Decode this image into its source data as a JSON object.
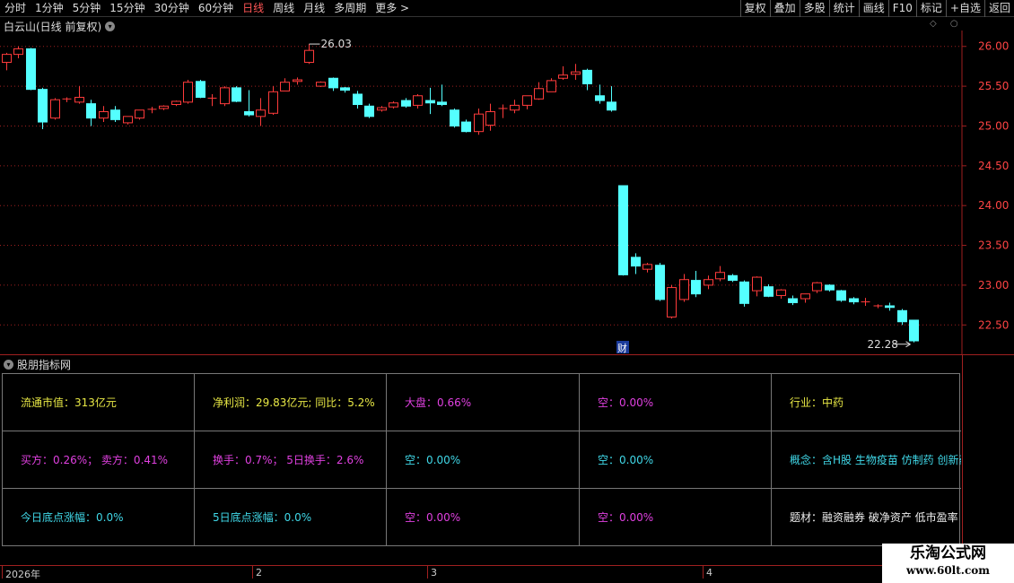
{
  "toolbar": {
    "periods": [
      "分时",
      "1分钟",
      "5分钟",
      "15分钟",
      "30分钟",
      "60分钟",
      "日线",
      "周线",
      "月线",
      "多周期",
      "更多 >"
    ],
    "active_period": "日线",
    "tools": [
      "复权",
      "叠加",
      "多股",
      "统计",
      "画线",
      "F10",
      "标记",
      "+自选",
      "返回"
    ]
  },
  "chart": {
    "title": "白云山(日线 前复权)",
    "header_icons": "◇ ○",
    "high_label": "26.03",
    "low_label": "22.28",
    "event_marker": "财"
  },
  "colors": {
    "up": "#ff3b3b",
    "down": "#54ffff",
    "grid": "#a02020",
    "axis_text": "#ff4444"
  },
  "panel": {
    "title": "股朋指标网",
    "rows": [
      [
        {
          "text": "流通市值：313亿元",
          "color": "yellow"
        },
        {
          "text": "净利润：29.83亿元;  同比：5.2%",
          "color": "yellow"
        },
        {
          "text": "大盘：0.66%",
          "color": "magenta"
        },
        {
          "text": "空：0.00%",
          "color": "magenta"
        },
        {
          "text": "行业：中药",
          "color": "yellow"
        }
      ],
      [
        {
          "text": "买方：0.26%；  卖方：0.41%",
          "color": "magenta"
        },
        {
          "text": "换手：0.7%；  5日换手：2.6%",
          "color": "magenta"
        },
        {
          "text": "空：0.00%",
          "color": "cyan"
        },
        {
          "text": "空：0.00%",
          "color": "cyan"
        },
        {
          "text": "概念：含H股 生物疫苗 仿制药 创新药",
          "color": "cyan"
        }
      ],
      [
        {
          "text": "今日底点涨幅：0.0%",
          "color": "cyan"
        },
        {
          "text": "5日底点涨幅：0.0%",
          "color": "cyan"
        },
        {
          "text": "空：0.00%",
          "color": "magenta"
        },
        {
          "text": "空：0.00%",
          "color": "magenta"
        },
        {
          "text": "题材：融资融券 破净资产 低市盈率 证",
          "color": "white"
        }
      ]
    ]
  },
  "date_axis": {
    "labels": [
      "2026年",
      "2",
      "3",
      "4"
    ]
  },
  "watermark": {
    "line1": "乐淘公式网",
    "line2": "www.60lt.com"
  },
  "chart_data": {
    "type": "candlestick",
    "title": "白云山(日线 前复权)",
    "y_ticks": [
      26.0,
      25.5,
      25.0,
      24.5,
      24.0,
      23.5,
      23.0,
      22.5
    ],
    "ylim": [
      22.12,
      26.2
    ],
    "high": 26.03,
    "low": 22.28,
    "candles": [
      {
        "o": 25.8,
        "h": 25.92,
        "l": 25.7,
        "c": 25.9
      },
      {
        "o": 25.9,
        "h": 26.0,
        "l": 25.85,
        "c": 25.97
      },
      {
        "o": 25.97,
        "h": 25.98,
        "l": 25.45,
        "c": 25.46
      },
      {
        "o": 25.46,
        "h": 25.48,
        "l": 24.96,
        "c": 25.05
      },
      {
        "o": 25.1,
        "h": 25.35,
        "l": 25.08,
        "c": 25.33
      },
      {
        "o": 25.33,
        "h": 25.36,
        "l": 25.3,
        "c": 25.34
      },
      {
        "o": 25.3,
        "h": 25.5,
        "l": 25.28,
        "c": 25.36
      },
      {
        "o": 25.28,
        "h": 25.33,
        "l": 25.0,
        "c": 25.1
      },
      {
        "o": 25.1,
        "h": 25.25,
        "l": 25.05,
        "c": 25.18
      },
      {
        "o": 25.2,
        "h": 25.25,
        "l": 25.05,
        "c": 25.08
      },
      {
        "o": 25.04,
        "h": 25.1,
        "l": 25.02,
        "c": 25.12
      },
      {
        "o": 25.1,
        "h": 25.2,
        "l": 25.08,
        "c": 25.2
      },
      {
        "o": 25.2,
        "h": 25.24,
        "l": 25.16,
        "c": 25.21
      },
      {
        "o": 25.22,
        "h": 25.26,
        "l": 25.2,
        "c": 25.25
      },
      {
        "o": 25.27,
        "h": 25.32,
        "l": 25.25,
        "c": 25.31
      },
      {
        "o": 25.3,
        "h": 25.58,
        "l": 25.28,
        "c": 25.55
      },
      {
        "o": 25.56,
        "h": 25.58,
        "l": 25.35,
        "c": 25.36
      },
      {
        "o": 25.35,
        "h": 25.4,
        "l": 25.25,
        "c": 25.35
      },
      {
        "o": 25.28,
        "h": 25.5,
        "l": 25.25,
        "c": 25.48
      },
      {
        "o": 25.48,
        "h": 25.5,
        "l": 25.3,
        "c": 25.31
      },
      {
        "o": 25.18,
        "h": 25.45,
        "l": 25.12,
        "c": 25.14
      },
      {
        "o": 25.12,
        "h": 25.35,
        "l": 25.0,
        "c": 25.2
      },
      {
        "o": 25.16,
        "h": 25.5,
        "l": 25.14,
        "c": 25.43
      },
      {
        "o": 25.44,
        "h": 25.6,
        "l": 25.44,
        "c": 25.55
      },
      {
        "o": 25.56,
        "h": 25.61,
        "l": 25.52,
        "c": 25.58
      },
      {
        "o": 25.8,
        "h": 26.03,
        "l": 25.78,
        "c": 25.95
      },
      {
        "o": 25.5,
        "h": 25.56,
        "l": 25.49,
        "c": 25.55
      },
      {
        "o": 25.6,
        "h": 25.61,
        "l": 25.44,
        "c": 25.48
      },
      {
        "o": 25.48,
        "h": 25.49,
        "l": 25.42,
        "c": 25.45
      },
      {
        "o": 25.4,
        "h": 25.44,
        "l": 25.22,
        "c": 25.27
      },
      {
        "o": 25.25,
        "h": 25.28,
        "l": 25.1,
        "c": 25.12
      },
      {
        "o": 25.2,
        "h": 25.25,
        "l": 25.18,
        "c": 25.23
      },
      {
        "o": 25.24,
        "h": 25.31,
        "l": 25.22,
        "c": 25.29
      },
      {
        "o": 25.32,
        "h": 25.35,
        "l": 25.23,
        "c": 25.25
      },
      {
        "o": 25.26,
        "h": 25.4,
        "l": 25.22,
        "c": 25.38
      },
      {
        "o": 25.32,
        "h": 25.48,
        "l": 25.15,
        "c": 25.29
      },
      {
        "o": 25.3,
        "h": 25.52,
        "l": 25.25,
        "c": 25.27
      },
      {
        "o": 25.2,
        "h": 25.22,
        "l": 24.98,
        "c": 25.0
      },
      {
        "o": 25.05,
        "h": 25.08,
        "l": 24.92,
        "c": 24.93
      },
      {
        "o": 24.93,
        "h": 25.22,
        "l": 24.89,
        "c": 25.15
      },
      {
        "o": 25.01,
        "h": 25.28,
        "l": 24.94,
        "c": 25.18
      },
      {
        "o": 25.22,
        "h": 25.27,
        "l": 25.1,
        "c": 25.22
      },
      {
        "o": 25.2,
        "h": 25.33,
        "l": 25.16,
        "c": 25.26
      },
      {
        "o": 25.26,
        "h": 25.35,
        "l": 25.21,
        "c": 25.38
      },
      {
        "o": 25.34,
        "h": 25.55,
        "l": 25.33,
        "c": 25.47
      },
      {
        "o": 25.43,
        "h": 25.6,
        "l": 25.43,
        "c": 25.57
      },
      {
        "o": 25.6,
        "h": 25.75,
        "l": 25.58,
        "c": 25.64
      },
      {
        "o": 25.65,
        "h": 25.78,
        "l": 25.58,
        "c": 25.68
      },
      {
        "o": 25.7,
        "h": 25.72,
        "l": 25.45,
        "c": 25.53
      },
      {
        "o": 25.38,
        "h": 25.52,
        "l": 25.28,
        "c": 25.32
      },
      {
        "o": 25.3,
        "h": 25.5,
        "l": 25.18,
        "c": 25.2
      },
      {
        "o": 24.25,
        "h": 24.25,
        "l": 23.12,
        "c": 23.13
      },
      {
        "o": 23.35,
        "h": 23.4,
        "l": 23.14,
        "c": 23.24
      },
      {
        "o": 23.2,
        "h": 23.28,
        "l": 23.16,
        "c": 23.26
      },
      {
        "o": 23.25,
        "h": 23.28,
        "l": 22.8,
        "c": 22.82
      },
      {
        "o": 22.6,
        "h": 23.0,
        "l": 22.58,
        "c": 22.97
      },
      {
        "o": 22.82,
        "h": 23.14,
        "l": 22.79,
        "c": 23.07
      },
      {
        "o": 23.06,
        "h": 23.18,
        "l": 22.85,
        "c": 22.89
      },
      {
        "o": 23.0,
        "h": 23.12,
        "l": 22.95,
        "c": 23.07
      },
      {
        "o": 23.08,
        "h": 23.24,
        "l": 23.05,
        "c": 23.16
      },
      {
        "o": 23.12,
        "h": 23.14,
        "l": 23.04,
        "c": 23.06
      },
      {
        "o": 23.04,
        "h": 23.06,
        "l": 22.73,
        "c": 22.77
      },
      {
        "o": 22.93,
        "h": 23.11,
        "l": 22.86,
        "c": 23.1
      },
      {
        "o": 22.98,
        "h": 23.01,
        "l": 22.85,
        "c": 22.86
      },
      {
        "o": 22.87,
        "h": 22.95,
        "l": 22.83,
        "c": 22.94
      },
      {
        "o": 22.83,
        "h": 22.87,
        "l": 22.75,
        "c": 22.78
      },
      {
        "o": 22.83,
        "h": 22.88,
        "l": 22.78,
        "c": 22.89
      },
      {
        "o": 22.93,
        "h": 23.04,
        "l": 22.9,
        "c": 23.03
      },
      {
        "o": 23.0,
        "h": 23.01,
        "l": 22.92,
        "c": 22.94
      },
      {
        "o": 22.93,
        "h": 22.94,
        "l": 22.79,
        "c": 22.81
      },
      {
        "o": 22.83,
        "h": 22.85,
        "l": 22.76,
        "c": 22.79
      },
      {
        "o": 22.79,
        "h": 22.84,
        "l": 22.74,
        "c": 22.79
      },
      {
        "o": 22.74,
        "h": 22.76,
        "l": 22.71,
        "c": 22.74
      },
      {
        "o": 22.74,
        "h": 22.78,
        "l": 22.68,
        "c": 22.72
      },
      {
        "o": 22.68,
        "h": 22.7,
        "l": 22.5,
        "c": 22.54
      },
      {
        "o": 22.56,
        "h": 22.56,
        "l": 22.28,
        "c": 22.3
      }
    ]
  }
}
